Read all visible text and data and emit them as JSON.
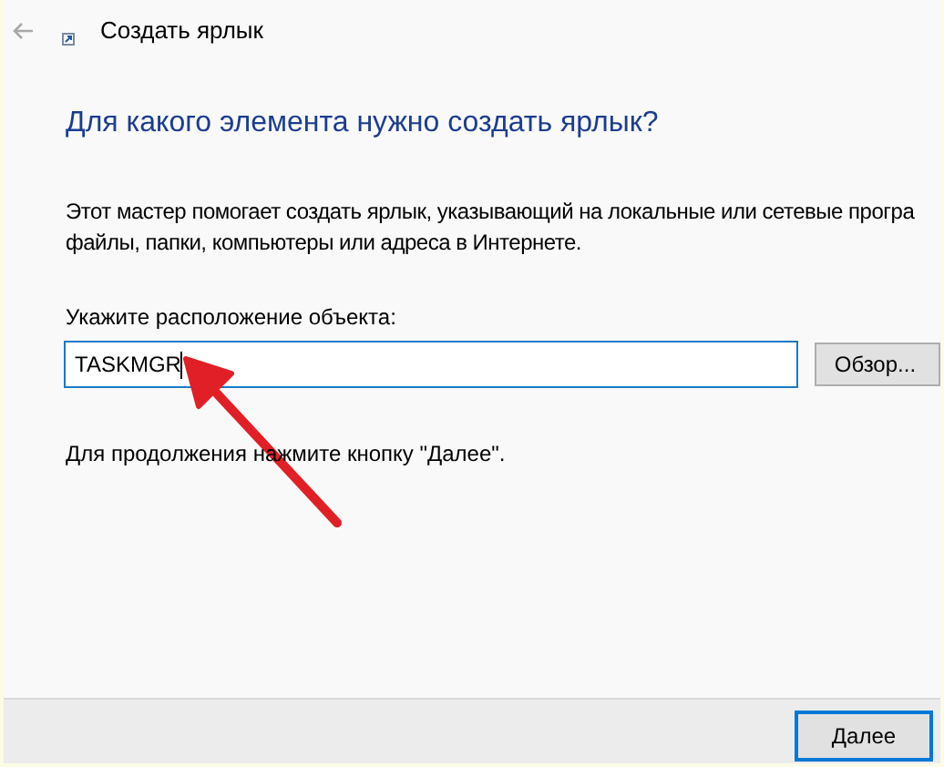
{
  "window": {
    "title": "Создать ярлык"
  },
  "heading": "Для какого элемента нужно создать ярлык?",
  "description": [
    "Этот мастер помогает создать ярлык, указывающий на локальные или сетевые програ",
    "файлы, папки, компьютеры или адреса в Интернете."
  ],
  "location": {
    "label": "Укажите расположение объекта:",
    "value": "TASKMGR",
    "browse_button": "Обзор..."
  },
  "hint": "Для продолжения нажмите кнопку \"Далее\".",
  "buttons": [
    "Далее"
  ]
}
